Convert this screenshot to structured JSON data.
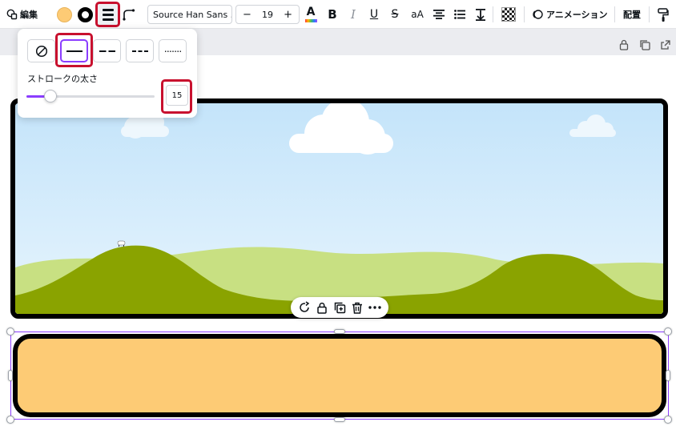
{
  "toolbar": {
    "edit_label": "編集",
    "font_name": "Source Han Sans ...",
    "font_size": "19",
    "minus_label": "−",
    "plus_label": "+",
    "text_color_label": "A",
    "bold_label": "B",
    "italic_label": "I",
    "underline_label": "U",
    "strike_label": "S",
    "case_label": "aA",
    "animation_label": "アニメーション",
    "position_label": "配置",
    "fill_color": "#fdcb75",
    "border_color": "#000000"
  },
  "stroke_popover": {
    "styles": [
      "none",
      "solid",
      "long-dash",
      "short-dash",
      "dotted"
    ],
    "selected_style": "solid",
    "weight_label": "ストロークの太さ",
    "weight_value": "15",
    "weight_fraction": 0.15
  },
  "canvas": {
    "shape_fill": "#fdcb75",
    "selection_color": "#8b3dff",
    "sky_color": "#c9e6fb",
    "hill_color": "#8aa300",
    "back_hill_color": "#c8e082"
  },
  "icons": {
    "quickbar": [
      "rotate-icon",
      "lock-icon",
      "duplicate-icon",
      "trash-icon",
      "more-icon"
    ],
    "page_actions": [
      "lock-icon",
      "duplicate-page-icon",
      "share-icon"
    ]
  }
}
